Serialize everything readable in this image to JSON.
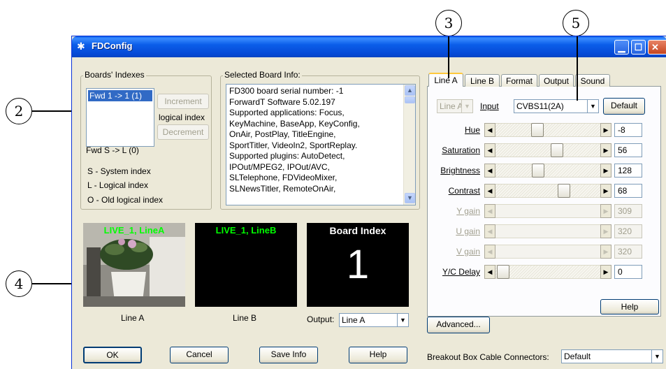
{
  "window": {
    "title": "FDConfig"
  },
  "boards": {
    "group_label": "Boards' Indexes",
    "list_item": "Fwd 1 -> 1 (1)",
    "increment": "Increment",
    "logical_index": "logical index",
    "decrement": "Decrement",
    "fwd_label": "Fwd S -> L (0)",
    "legend": [
      "S - System index",
      "L - Logical index",
      "O - Old logical index"
    ]
  },
  "board_info": {
    "group_label": "Selected Board Info:",
    "lines": [
      "FD300 board serial number: -1",
      "ForwardT Software 5.02.197",
      "Supported applications: Focus,",
      "KeyMachine, BaseApp, KeyConfig,",
      "OnAir, PostPlay, TitleEngine,",
      "SportTitler, VideoIn2, SportReplay.",
      "Supported plugins: AutoDetect,",
      "IPOut/MPEG2, IPOut/AVC,",
      "SLTelephone, FDVideoMixer,",
      "SLNewsTitler, RemoteOnAir,"
    ]
  },
  "previews": {
    "lineA_title": "LIVE_1, LineA",
    "lineB_title": "LIVE_1, LineB",
    "board_index_title": "Board Index",
    "board_index_value": "1",
    "caption_a": "Line A",
    "caption_b": "Line B",
    "output_label": "Output:",
    "output_value": "Line A"
  },
  "buttons": {
    "ok": "OK",
    "cancel": "Cancel",
    "save_info": "Save Info",
    "help": "Help"
  },
  "tabs": [
    "Line A",
    "Line B",
    "Format",
    "Output",
    "Sound"
  ],
  "line_panel": {
    "line_select": "Line A",
    "input_label": "Input",
    "input_value": "CVBS11(2A)",
    "default_button": "Default",
    "sliders": [
      {
        "label": "Hue",
        "value": "-8",
        "enabled": true
      },
      {
        "label": "Saturation",
        "value": "56",
        "enabled": true
      },
      {
        "label": "Brightness",
        "value": "128",
        "enabled": true
      },
      {
        "label": "Contrast",
        "value": "68",
        "enabled": true
      },
      {
        "label": "Y gain",
        "value": "309",
        "enabled": false
      },
      {
        "label": "U gain",
        "value": "320",
        "enabled": false
      },
      {
        "label": "V gain",
        "value": "320",
        "enabled": false
      },
      {
        "label": "Y/C Delay",
        "value": "0",
        "enabled": true
      }
    ],
    "help_button": "Help"
  },
  "advanced_button": "Advanced...",
  "breakout": {
    "label": "Breakout Box Cable Connectors:",
    "value": "Default"
  },
  "callouts": [
    "2",
    "3",
    "4",
    "5"
  ],
  "colors": {
    "titlebar": "#0a5ce8",
    "preview_text": "#00ff00",
    "tab_highlight": "#ffc83c"
  }
}
